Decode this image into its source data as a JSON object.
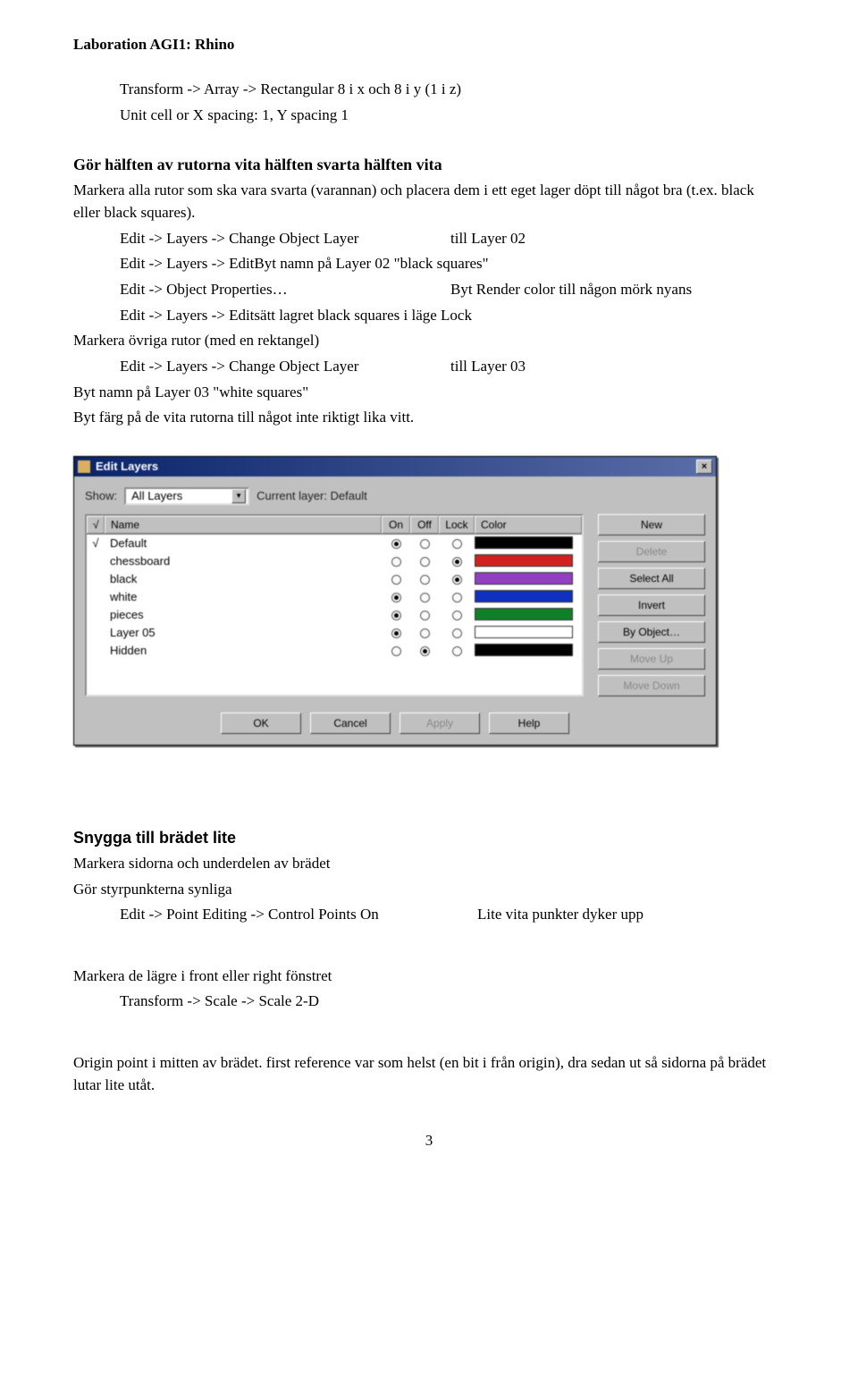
{
  "header": "Laboration AGI1:  Rhino",
  "line1": "Transform -> Array -> Rectangular   8 i x och 8 i y (1 i z)",
  "line2": "Unit cell or X spacing: 1, Y spacing 1",
  "sec1_title": "Gör hälften av rutorna vita hälften svarta hälften vita",
  "sec1_p1": "Markera alla rutor som ska vara svarta (varannan) och placera dem i ett eget lager döpt till något bra (t.ex. black eller black squares).",
  "sec1_r1_left": "Edit -> Layers -> Change Object Layer",
  "sec1_r1_right": "till Layer 02",
  "sec1_r2": "Edit -> Layers -> EditByt namn på Layer 02 \"black squares\"",
  "sec1_r3_left": "Edit -> Object Properties…",
  "sec1_r3_right": "Byt Render color till någon mörk nyans",
  "sec1_r4": "Edit -> Layers -> Editsätt lagret black squares i läge Lock",
  "sec1_p2": "Markera övriga rutor (med en rektangel)",
  "sec1_r5_left": "Edit -> Layers -> Change Object Layer",
  "sec1_r5_right": "till Layer 03",
  "sec1_p3": "Byt namn på Layer 03 \"white squares\"",
  "sec1_p4": "Byt färg på de vita rutorna till något inte riktigt lika vitt.",
  "dialog": {
    "title": "Edit Layers",
    "show_label": "Show:",
    "show_value": "All Layers",
    "current_label": "Current layer:   Default",
    "headers": {
      "chk": "√",
      "name": "Name",
      "on": "On",
      "off": "Off",
      "lock": "Lock",
      "color": "Color"
    },
    "rows": [
      {
        "chk": "√",
        "name": "Default",
        "state": "on",
        "color": "#000000"
      },
      {
        "chk": "",
        "name": "chessboard",
        "state": "lock",
        "color": "#d02020"
      },
      {
        "chk": "",
        "name": "black",
        "state": "lock",
        "color": "#9040c0"
      },
      {
        "chk": "",
        "name": "white",
        "state": "on",
        "color": "#1030c0"
      },
      {
        "chk": "",
        "name": "pieces",
        "state": "on",
        "color": "#108028"
      },
      {
        "chk": "",
        "name": "Layer 05",
        "state": "on",
        "color": "#ffffff"
      },
      {
        "chk": "",
        "name": "Hidden",
        "state": "off",
        "color": "#000000"
      }
    ],
    "buttons_side": [
      "New",
      "Delete",
      "Select All",
      "Invert",
      "By Object…",
      "Move Up",
      "Move Down"
    ],
    "buttons_bottom": [
      "OK",
      "Cancel",
      "Apply",
      "Help"
    ]
  },
  "sec2_title": "Snygga till brädet lite",
  "sec2_p1": "Markera sidorna och underdelen av brädet",
  "sec2_p2": "Gör styrpunkterna synliga",
  "sec2_r1_left": "Edit -> Point Editing -> Control Points On",
  "sec2_r1_right": "Lite vita punkter dyker upp",
  "sec2_p3": "Markera de lägre i front eller right fönstret",
  "sec2_r2": "Transform -> Scale -> Scale 2-D",
  "sec2_p4": "Origin point i mitten av brädet. first reference var som helst (en bit i från origin), dra sedan ut så sidorna på brädet lutar lite utåt.",
  "pagenum": "3"
}
